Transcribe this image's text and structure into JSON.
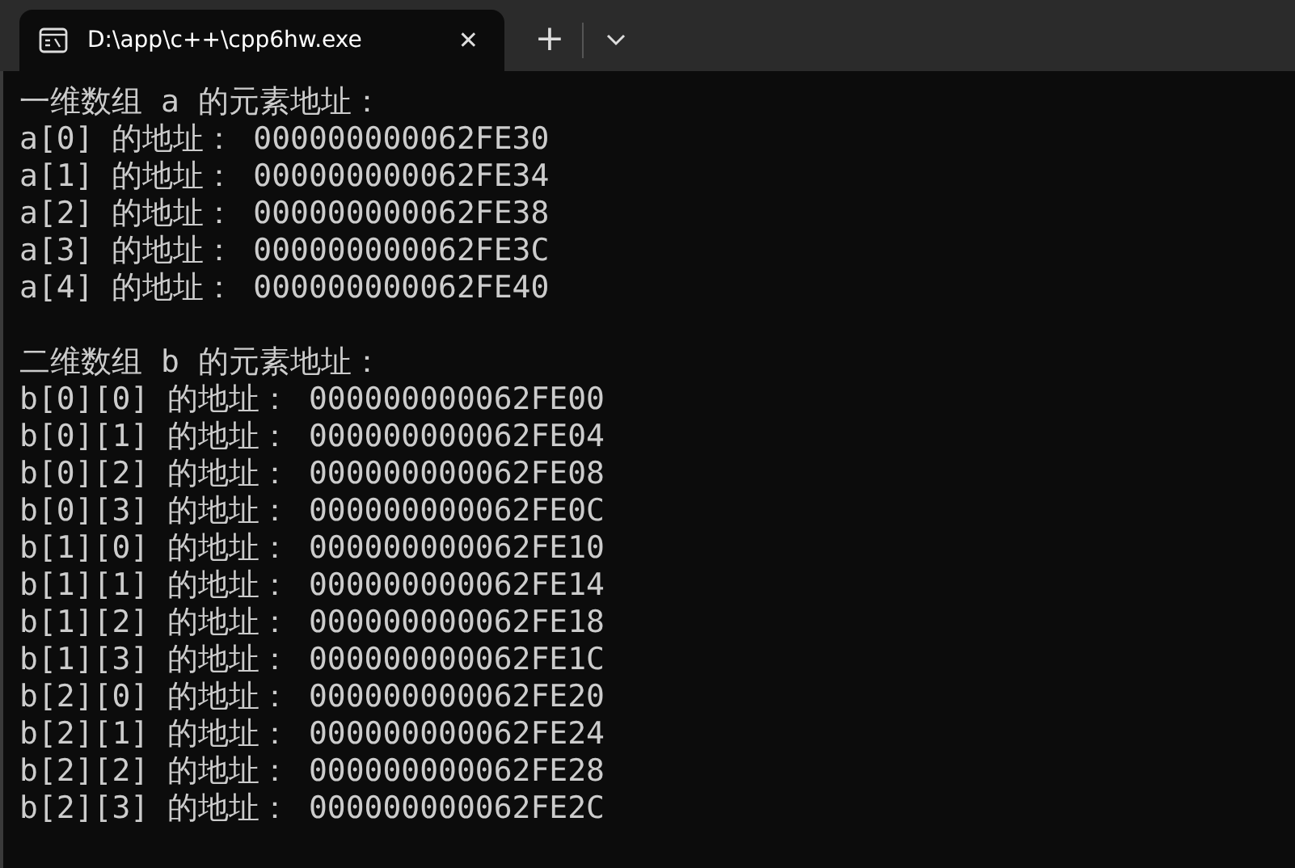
{
  "tab": {
    "title": "D:\\app\\c++\\cpp6hw.exe",
    "close": "✕",
    "selected": true
  },
  "new_tab": "+",
  "console": [
    {
      "heading": "一维数组 a 的元素地址：",
      "lines": [
        "a[0] 的地址： 000000000062FE30",
        "a[1] 的地址： 000000000062FE34",
        "a[2] 的地址： 000000000062FE38",
        "a[3] 的地址： 000000000062FE3C",
        "a[4] 的地址： 000000000062FE40"
      ]
    },
    {
      "heading": "二维数组 b 的元素地址：",
      "lines": [
        "b[0][0] 的地址： 000000000062FE00",
        "b[0][1] 的地址： 000000000062FE04",
        "b[0][2] 的地址： 000000000062FE08",
        "b[0][3] 的地址： 000000000062FE0C",
        "b[1][0] 的地址： 000000000062FE10",
        "b[1][1] 的地址： 000000000062FE14",
        "b[1][2] 的地址： 000000000062FE18",
        "b[1][3] 的地址： 000000000062FE1C",
        "b[2][0] 的地址： 000000000062FE20",
        "b[2][1] 的地址： 000000000062FE24",
        "b[2][2] 的地址： 000000000062FE28",
        "b[2][3] 的地址： 000000000062FE2C"
      ]
    }
  ]
}
